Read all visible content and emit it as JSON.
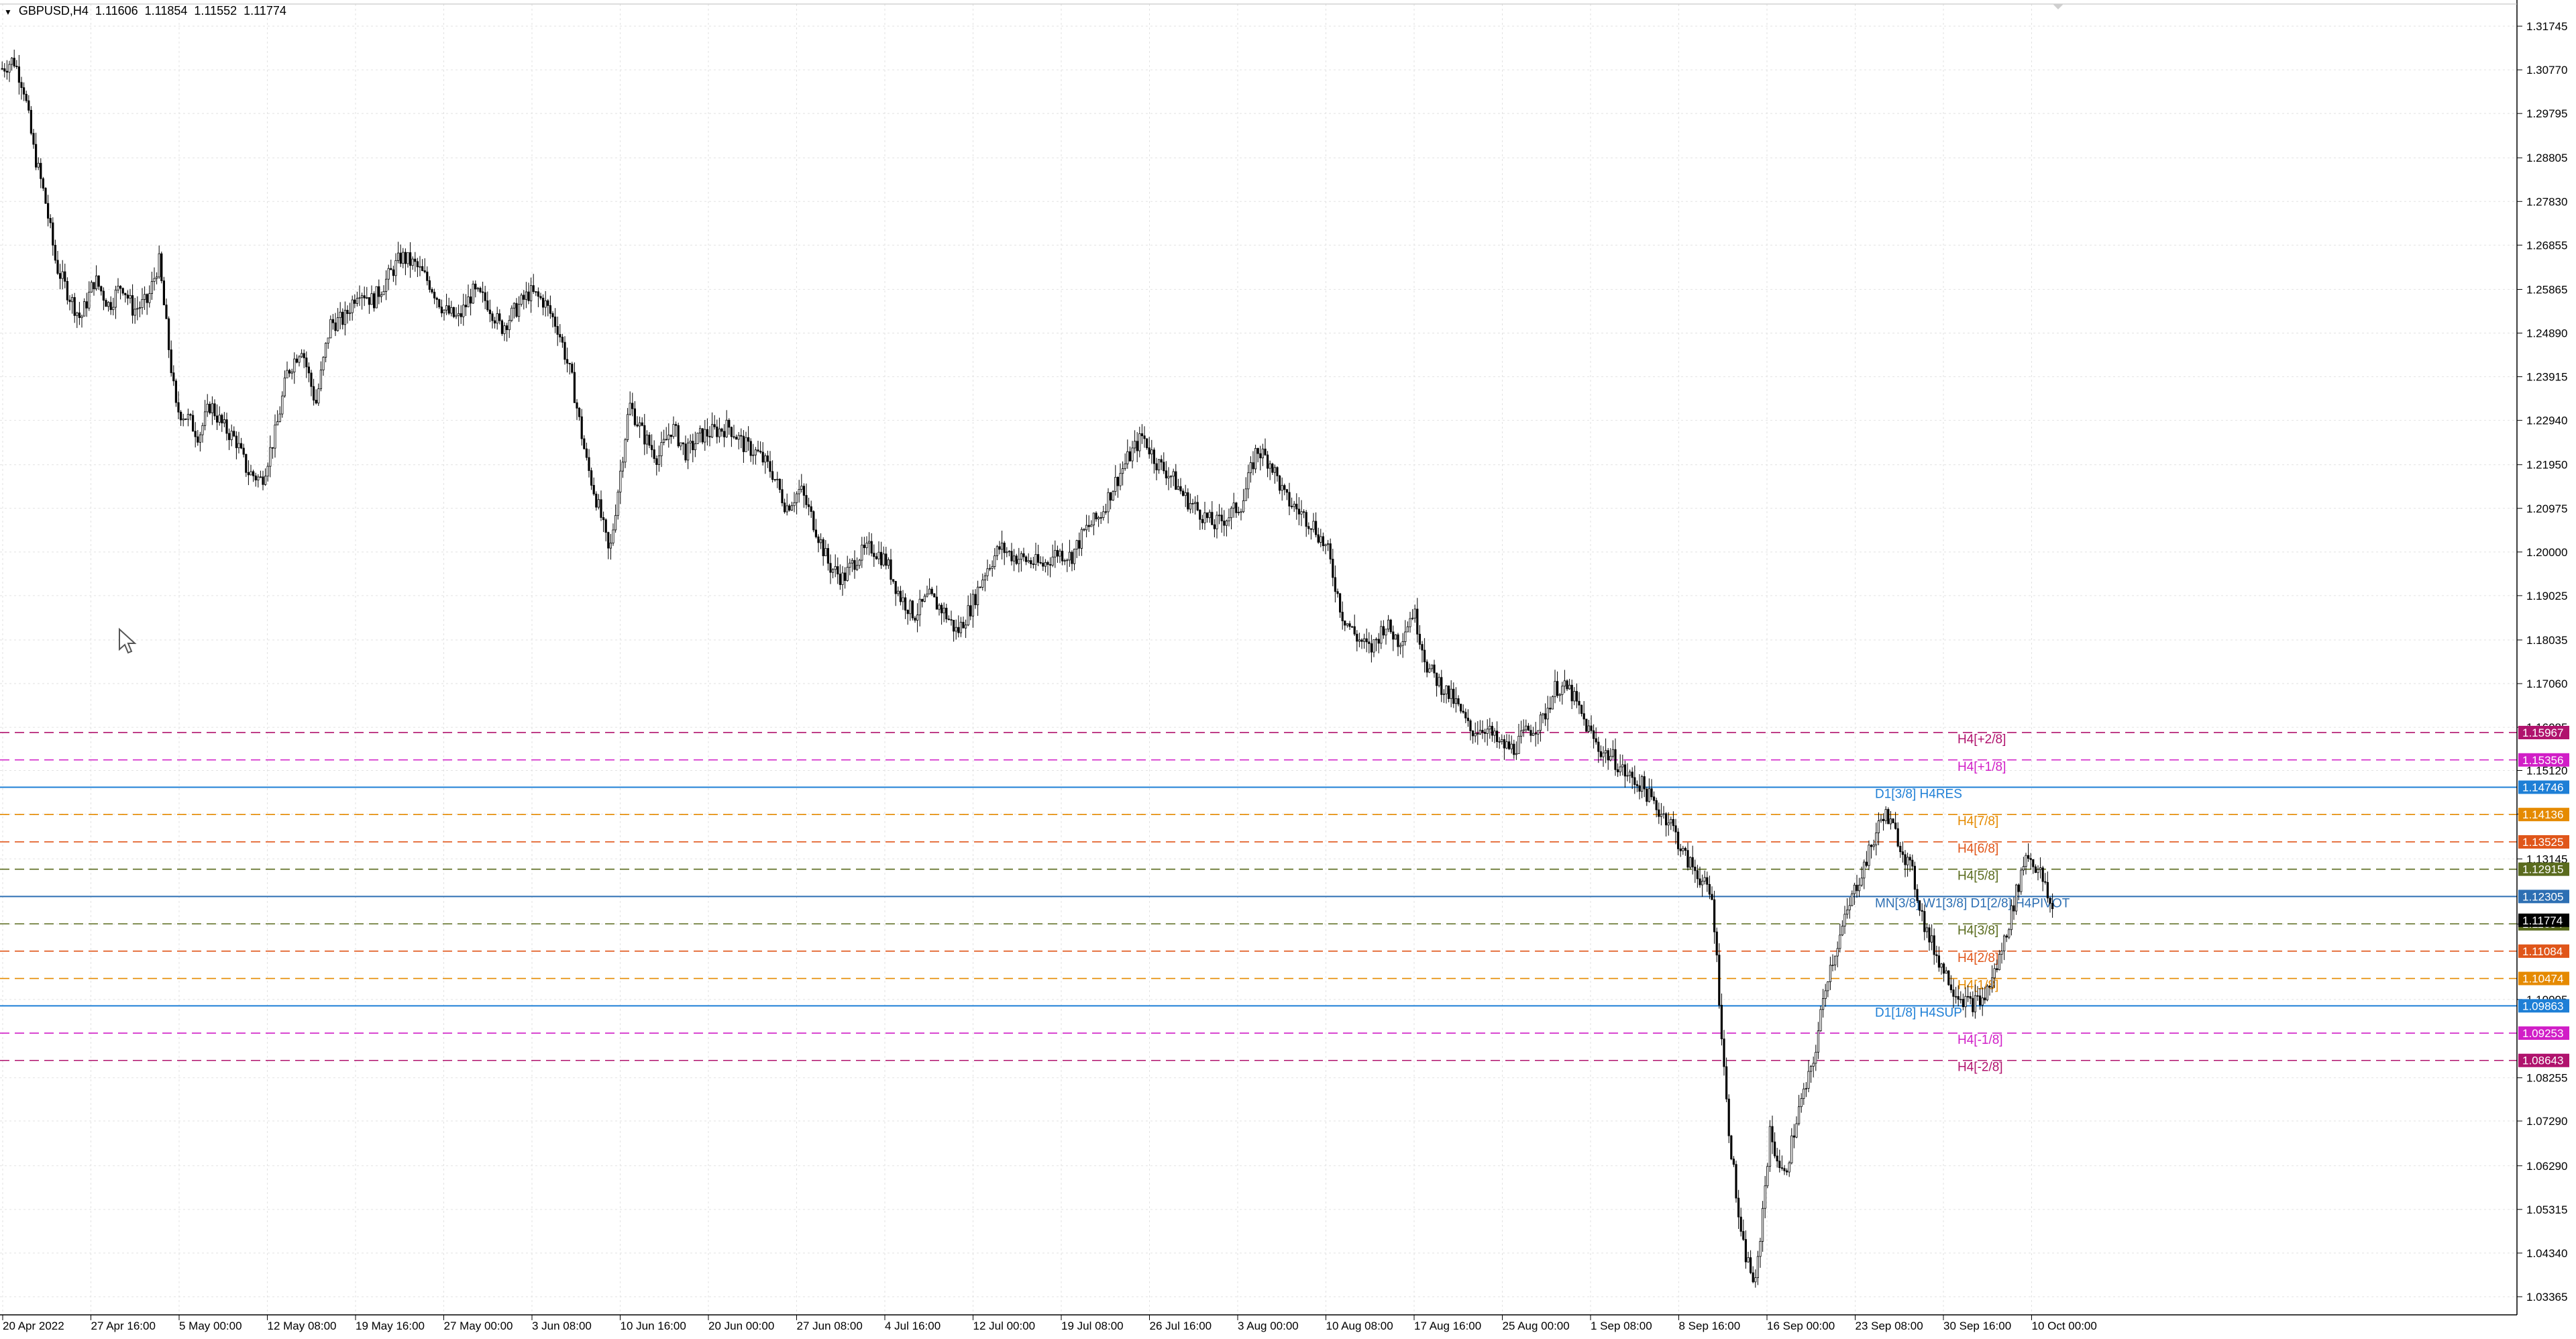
{
  "header": {
    "symbol": "GBPUSD,H4",
    "open": "1.11606",
    "high": "1.11854",
    "low": "1.11552",
    "close": "1.11774",
    "menu_glyph": "▼"
  },
  "colors": {
    "background": "#ffffff",
    "grid": "#e2e2e2",
    "candle": "#000000",
    "axis_text": "#000000",
    "resistance_blue": "#1e7fd6",
    "pivot_blue": "#2d6fb3"
  },
  "chart_data": {
    "type": "line",
    "symbol": "GBPUSD",
    "timeframe": "H4",
    "ylim": [
      1.0296,
      1.3224
    ],
    "price_ticks": [
      "1.31745",
      "1.30770",
      "1.29795",
      "1.28805",
      "1.27830",
      "1.26855",
      "1.25865",
      "1.24890",
      "1.23915",
      "1.22940",
      "1.21950",
      "1.20975",
      "1.20000",
      "1.19025",
      "1.18035",
      "1.17060",
      "1.16085",
      "1.15120",
      "1.14145",
      "1.13145",
      "1.11690",
      "1.10005",
      "1.08255",
      "1.07290",
      "1.06290",
      "1.05315",
      "1.04340",
      "1.03365"
    ],
    "time_labels": [
      "20 Apr 2022",
      "27 Apr 16:00",
      "5 May 00:00",
      "12 May 08:00",
      "19 May 16:00",
      "27 May 00:00",
      "3 Jun 08:00",
      "10 Jun 16:00",
      "20 Jun 00:00",
      "27 Jun 08:00",
      "4 Jul 16:00",
      "12 Jul 00:00",
      "19 Jul 08:00",
      "26 Jul 16:00",
      "3 Aug 00:00",
      "10 Aug 08:00",
      "17 Aug 16:00",
      "25 Aug 00:00",
      "1 Sep 08:00",
      "8 Sep 16:00",
      "16 Sep 00:00",
      "23 Sep 08:00",
      "30 Sep 16:00",
      "10 Oct 00:00"
    ],
    "close_path": [
      [
        0,
        1.308
      ],
      [
        0.8,
        1.31
      ],
      [
        1.5,
        1.304
      ],
      [
        2.2,
        1.29
      ],
      [
        3,
        1.279
      ],
      [
        3.8,
        1.264
      ],
      [
        4.6,
        1.258
      ],
      [
        5.5,
        1.252
      ],
      [
        6.5,
        1.261
      ],
      [
        7.5,
        1.255
      ],
      [
        8.4,
        1.26
      ],
      [
        9.2,
        1.254
      ],
      [
        10.2,
        1.256
      ],
      [
        11,
        1.265
      ],
      [
        11.6,
        1.248
      ],
      [
        12.2,
        1.232
      ],
      [
        13,
        1.23
      ],
      [
        13.8,
        1.226
      ],
      [
        14.6,
        1.233
      ],
      [
        15.5,
        1.228
      ],
      [
        16.4,
        1.225
      ],
      [
        17.2,
        1.218
      ],
      [
        18.2,
        1.216
      ],
      [
        19.2,
        1.227
      ],
      [
        20,
        1.24
      ],
      [
        21,
        1.246
      ],
      [
        22,
        1.233
      ],
      [
        23,
        1.251
      ],
      [
        24,
        1.252
      ],
      [
        25,
        1.259
      ],
      [
        26,
        1.256
      ],
      [
        27,
        1.261
      ],
      [
        28,
        1.266
      ],
      [
        29,
        1.264
      ],
      [
        30,
        1.26
      ],
      [
        31,
        1.254
      ],
      [
        32,
        1.252
      ],
      [
        33,
        1.258
      ],
      [
        34,
        1.256
      ],
      [
        35,
        1.25
      ],
      [
        36,
        1.254
      ],
      [
        37,
        1.258
      ],
      [
        38,
        1.256
      ],
      [
        39,
        1.25
      ],
      [
        40,
        1.238
      ],
      [
        41,
        1.22
      ],
      [
        42,
        1.208
      ],
      [
        42.6,
        1.199
      ],
      [
        43.2,
        1.214
      ],
      [
        44,
        1.233
      ],
      [
        45,
        1.226
      ],
      [
        46,
        1.221
      ],
      [
        47,
        1.228
      ],
      [
        48,
        1.222
      ],
      [
        49,
        1.226
      ],
      [
        50,
        1.227
      ],
      [
        51,
        1.228
      ],
      [
        52,
        1.224
      ],
      [
        53,
        1.222
      ],
      [
        54,
        1.218
      ],
      [
        55,
        1.21
      ],
      [
        56,
        1.214
      ],
      [
        57,
        1.206
      ],
      [
        58,
        1.197
      ],
      [
        59,
        1.194
      ],
      [
        60,
        1.199
      ],
      [
        61,
        1.201
      ],
      [
        62,
        1.198
      ],
      [
        63,
        1.19
      ],
      [
        64,
        1.186
      ],
      [
        65,
        1.19
      ],
      [
        66,
        1.187
      ],
      [
        67,
        1.182
      ],
      [
        68,
        1.188
      ],
      [
        69,
        1.196
      ],
      [
        70,
        1.201
      ],
      [
        71,
        1.199
      ],
      [
        72,
        1.198
      ],
      [
        73,
        1.197
      ],
      [
        74,
        1.2
      ],
      [
        75,
        1.199
      ],
      [
        76,
        1.205
      ],
      [
        77,
        1.208
      ],
      [
        78,
        1.215
      ],
      [
        79,
        1.221
      ],
      [
        80,
        1.226
      ],
      [
        81,
        1.22
      ],
      [
        82,
        1.217
      ],
      [
        83,
        1.212
      ],
      [
        84,
        1.209
      ],
      [
        85,
        1.206
      ],
      [
        86,
        1.208
      ],
      [
        87,
        1.211
      ],
      [
        88,
        1.223
      ],
      [
        89,
        1.22
      ],
      [
        90,
        1.212
      ],
      [
        91,
        1.209
      ],
      [
        92,
        1.206
      ],
      [
        93,
        1.2
      ],
      [
        94,
        1.186
      ],
      [
        95,
        1.181
      ],
      [
        96,
        1.178
      ],
      [
        97,
        1.184
      ],
      [
        98,
        1.18
      ],
      [
        99,
        1.187
      ],
      [
        100,
        1.174
      ],
      [
        101,
        1.17
      ],
      [
        102,
        1.166
      ],
      [
        103,
        1.16
      ],
      [
        104,
        1.161
      ],
      [
        105,
        1.157
      ],
      [
        106,
        1.156
      ],
      [
        107,
        1.16
      ],
      [
        108,
        1.162
      ],
      [
        109,
        1.17
      ],
      [
        110,
        1.169
      ],
      [
        111,
        1.162
      ],
      [
        112,
        1.156
      ],
      [
        113,
        1.154
      ],
      [
        114,
        1.15
      ],
      [
        115,
        1.148
      ],
      [
        116,
        1.143
      ],
      [
        117,
        1.14
      ],
      [
        118,
        1.132
      ],
      [
        119,
        1.128
      ],
      [
        120,
        1.122
      ],
      [
        121,
        1.075
      ],
      [
        122,
        1.046
      ],
      [
        123,
        1.036
      ],
      [
        124,
        1.07
      ],
      [
        125,
        1.06
      ],
      [
        126,
        1.075
      ],
      [
        127,
        1.085
      ],
      [
        128,
        1.105
      ],
      [
        129,
        1.115
      ],
      [
        130,
        1.125
      ],
      [
        131,
        1.133
      ],
      [
        132,
        1.142
      ],
      [
        133,
        1.136
      ],
      [
        134,
        1.128
      ],
      [
        135,
        1.115
      ],
      [
        136,
        1.108
      ],
      [
        137,
        1.102
      ],
      [
        138,
        1.099
      ],
      [
        139,
        1.1
      ],
      [
        140,
        1.108
      ],
      [
        141,
        1.12
      ],
      [
        142,
        1.133
      ],
      [
        143,
        1.128
      ],
      [
        144,
        1.118
      ]
    ],
    "levels": [
      {
        "label": "H4[+2/8]",
        "price": "1.15967",
        "value": 1.15967,
        "color": "#b0136d",
        "style": "dashed"
      },
      {
        "label": "H4[+1/8]",
        "price": "1.15356",
        "value": 1.15356,
        "color": "#d11ec7",
        "style": "dashed"
      },
      {
        "label": "D1[3/8] H4RES",
        "price": "1.14746",
        "value": 1.14746,
        "color": "#1e7fd6",
        "style": "solid"
      },
      {
        "label": "H4[7/8]",
        "price": "1.14136",
        "value": 1.14136,
        "color": "#e58a00",
        "style": "dashed"
      },
      {
        "label": "H4[6/8]",
        "price": "1.13525",
        "value": 1.13525,
        "color": "#e0561a",
        "style": "dashed"
      },
      {
        "label": "H4[5/8]",
        "price": "1.12915",
        "value": 1.12915,
        "color": "#5a6b1e",
        "style": "dashed"
      },
      {
        "label": "MN[3/8] W1[3/8] D1[2/8] H4PIVOT",
        "price": "1.12305",
        "value": 1.12305,
        "color": "#2d6fb3",
        "style": "solid"
      },
      {
        "label": "H4[3/8]",
        "price": "1.11694",
        "value": 1.11694,
        "color": "#5a6b1e",
        "style": "dashed"
      },
      {
        "label": "H4[2/8]",
        "price": "1.11084",
        "value": 1.11084,
        "color": "#e0561a",
        "style": "dashed"
      },
      {
        "label": "H4[1/8]",
        "price": "1.10474",
        "value": 1.10474,
        "color": "#e58a00",
        "style": "dashed"
      },
      {
        "label": "D1[1/8] H4SUP",
        "price": "1.09863",
        "value": 1.09863,
        "color": "#1e7fd6",
        "style": "solid"
      },
      {
        "label": "H4[-1/8]",
        "price": "1.09253",
        "value": 1.09253,
        "color": "#d11ec7",
        "style": "dashed"
      },
      {
        "label": "H4[-2/8]",
        "price": "1.08643",
        "value": 1.08643,
        "color": "#b0136d",
        "style": "dashed"
      }
    ],
    "current_price_tag": {
      "price": "1.11774",
      "value": 1.11774,
      "color": "#000000"
    },
    "grid": true
  }
}
